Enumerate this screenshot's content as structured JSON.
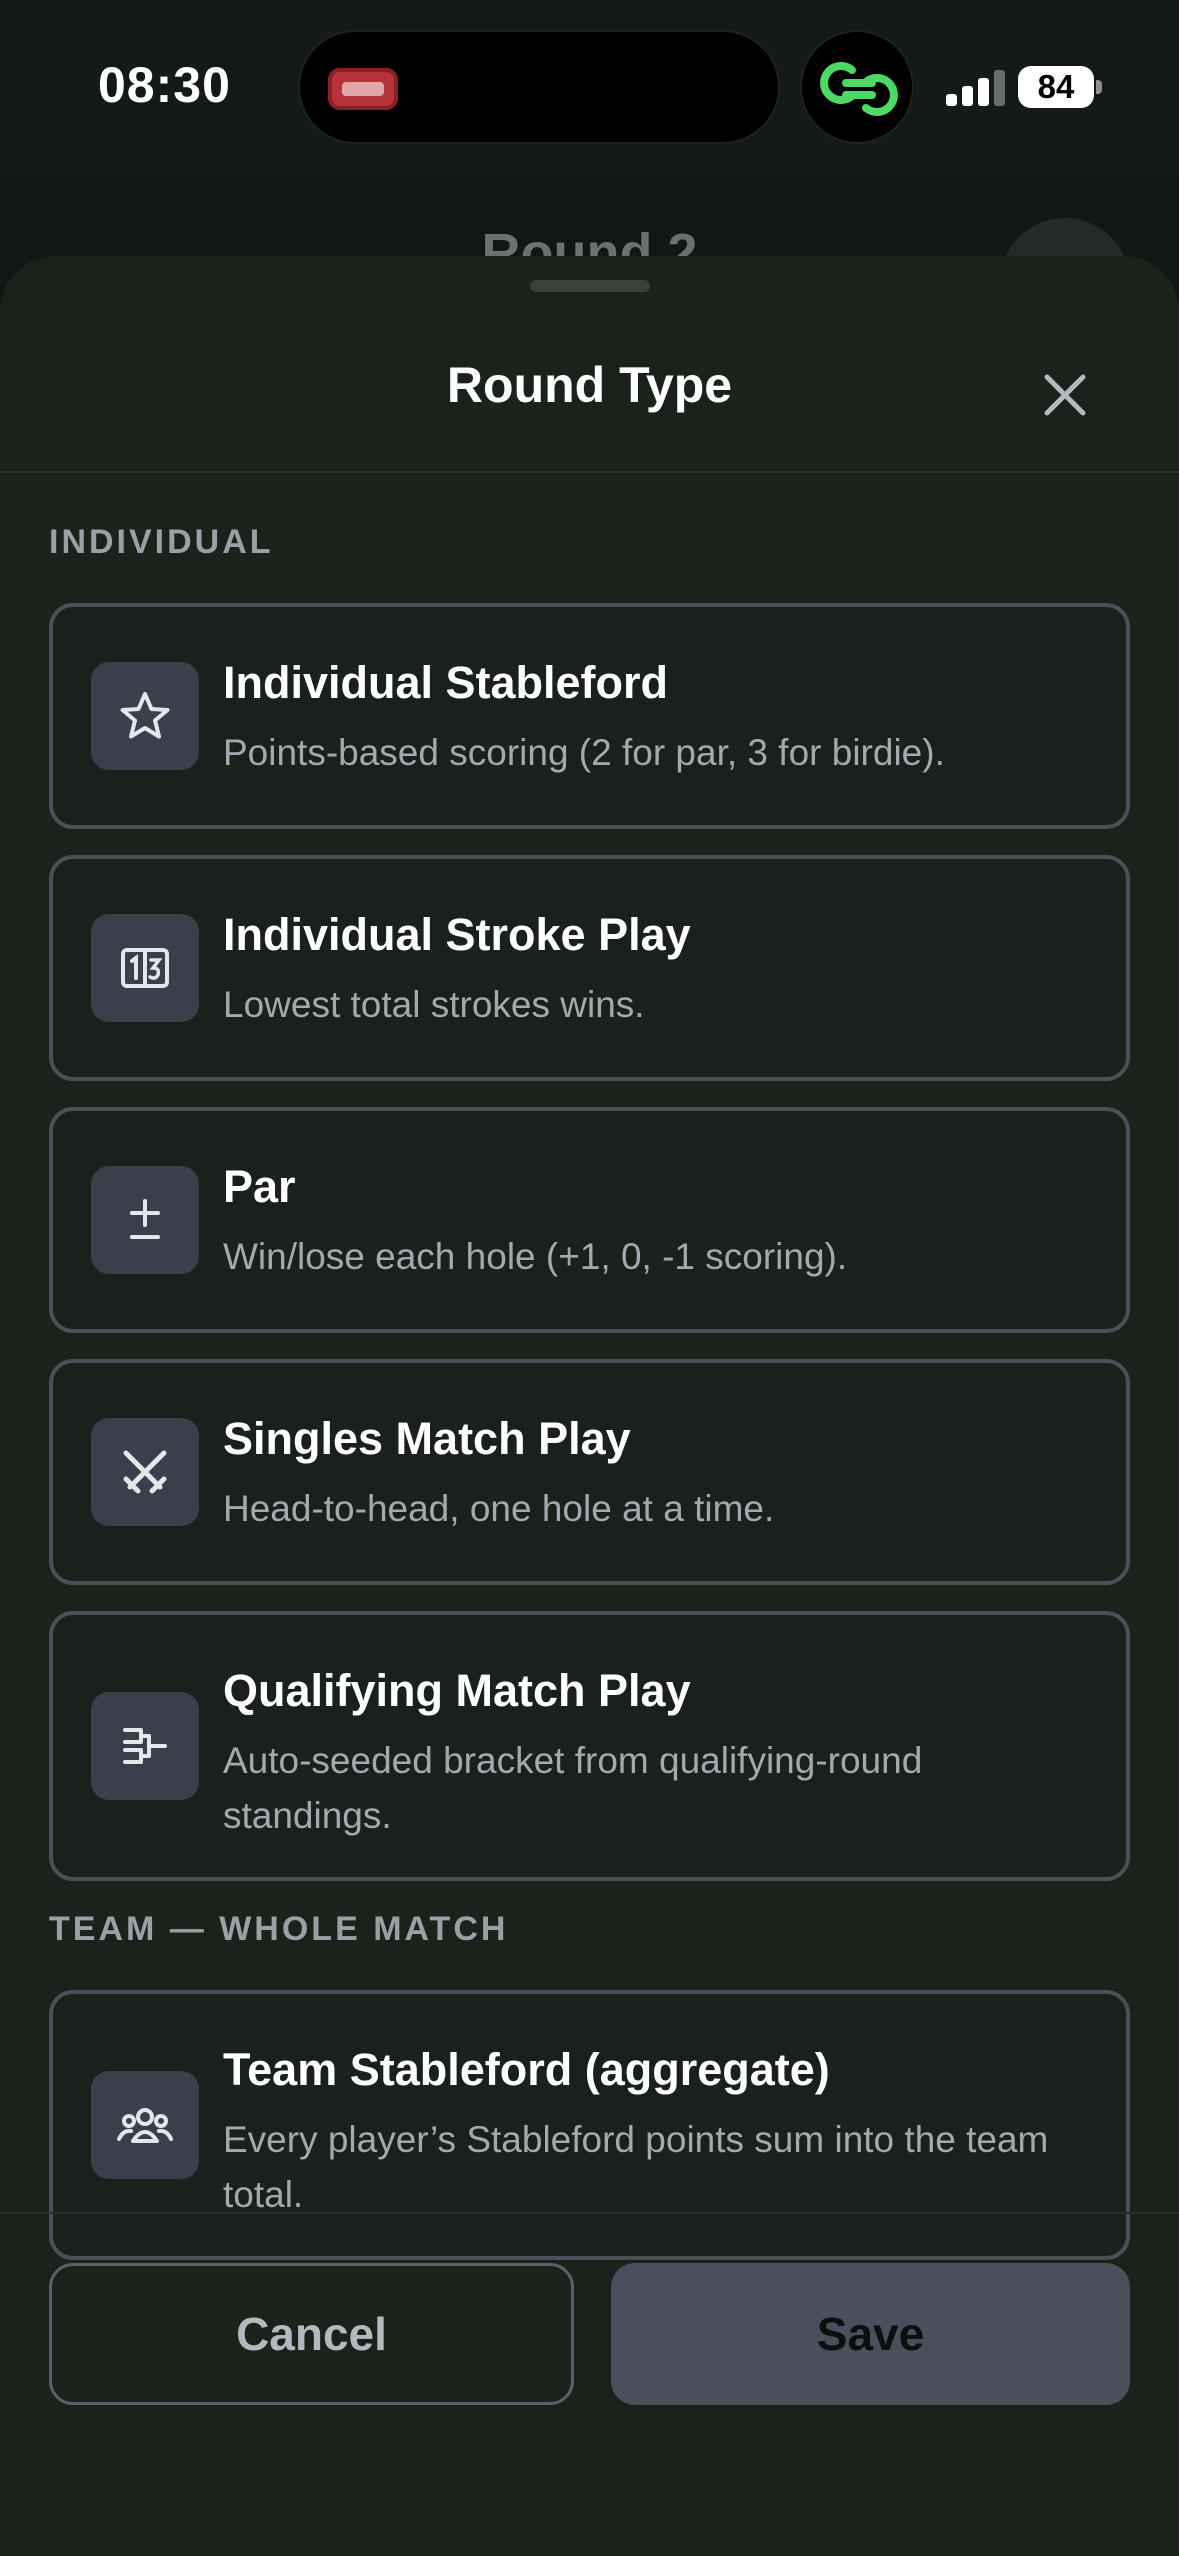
{
  "status_bar": {
    "time": "08:30",
    "battery": "84",
    "island_thumb_icon": "app-thumbnail-icon",
    "link_icon": "link-rings-icon",
    "accent_green": "#4cd964"
  },
  "background_page": {
    "title": "Round 2"
  },
  "sheet": {
    "title": "Round Type",
    "close_icon": "close-icon"
  },
  "sections": {
    "individual": {
      "label": "INDIVIDUAL",
      "options": [
        {
          "title": "Individual Stableford",
          "description": "Points-based scoring (2 for par, 3 for birdie).",
          "icon": "star-icon"
        },
        {
          "title": "Individual Stroke Play",
          "description": "Lowest total strokes wins.",
          "icon": "scorecard-icon"
        },
        {
          "title": "Par",
          "description": "Win/lose each hole (+1, 0, -1 scoring).",
          "icon": "plus-minus-icon"
        },
        {
          "title": "Singles Match Play",
          "description": "Head-to-head, one hole at a time.",
          "icon": "crossed-swords-icon"
        },
        {
          "title": "Qualifying Match Play",
          "description": "Auto-seeded bracket from qualifying-round standings.",
          "icon": "bracket-icon"
        }
      ]
    },
    "team": {
      "label": "TEAM — WHOLE MATCH",
      "options": [
        {
          "title": "Team Stableford (aggregate)",
          "description": "Every player’s Stableford points sum into the team total.",
          "icon": "team-icon"
        }
      ]
    }
  },
  "footer": {
    "cancel_label": "Cancel",
    "save_label": "Save"
  }
}
